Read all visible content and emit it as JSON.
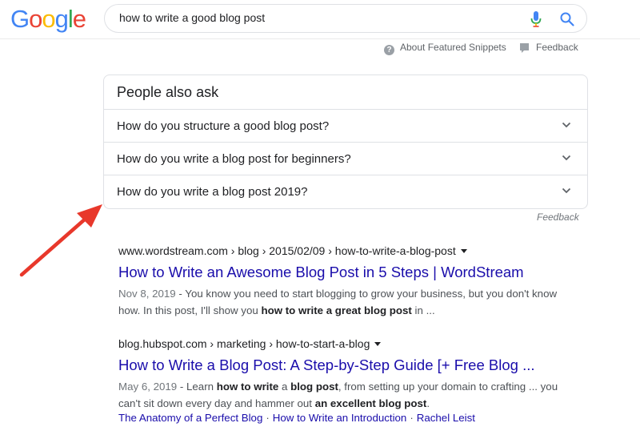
{
  "logo": [
    "G",
    "o",
    "o",
    "g",
    "l",
    "e"
  ],
  "search": {
    "query": "how to write a good blog post"
  },
  "snippet_footer": {
    "about": "About Featured Snippets",
    "feedback": "Feedback"
  },
  "paa": {
    "title": "People also ask",
    "questions": [
      "How do you structure a good blog post?",
      "How do you write a blog post for beginners?",
      "How do you write a blog post 2019?"
    ],
    "feedback": "Feedback"
  },
  "results": [
    {
      "cite": "www.wordstream.com › blog › 2015/02/09 › how-to-write-a-blog-post",
      "title": "How to Write an Awesome Blog Post in 5 Steps | WordStream",
      "date": "Nov 8, 2019",
      "snippet_1": " - You know you need to start blogging to grow your business, but you don't know how. In this post, I'll show you ",
      "snippet_bold": "how to write a great blog post",
      "snippet_2": " in ..."
    },
    {
      "cite": "blog.hubspot.com › marketing › how-to-start-a-blog",
      "title": "How to Write a Blog Post: A Step-by-Step Guide [+ Free Blog ...",
      "date": "May 6, 2019",
      "snippet_1": " - Learn ",
      "snippet_bold_1": "how to write",
      "snippet_mid_1": " a ",
      "snippet_bold_2": "blog post",
      "snippet_mid_2": ", from setting up your domain to crafting ... you can't sit down every day and hammer out ",
      "snippet_bold_3": "an excellent blog post",
      "snippet_end": ".",
      "sitelinks": [
        "The Anatomy of a Perfect Blog",
        "How to Write an Introduction",
        "Rachel Leist"
      ]
    }
  ],
  "colors": {
    "link": "#1a0dab",
    "annotation": "#e8382b"
  },
  "icons": {
    "mic": "mic-icon",
    "search": "search-icon",
    "help": "help-icon",
    "feedback": "flag-icon",
    "chevron": "chevron-down-icon"
  }
}
